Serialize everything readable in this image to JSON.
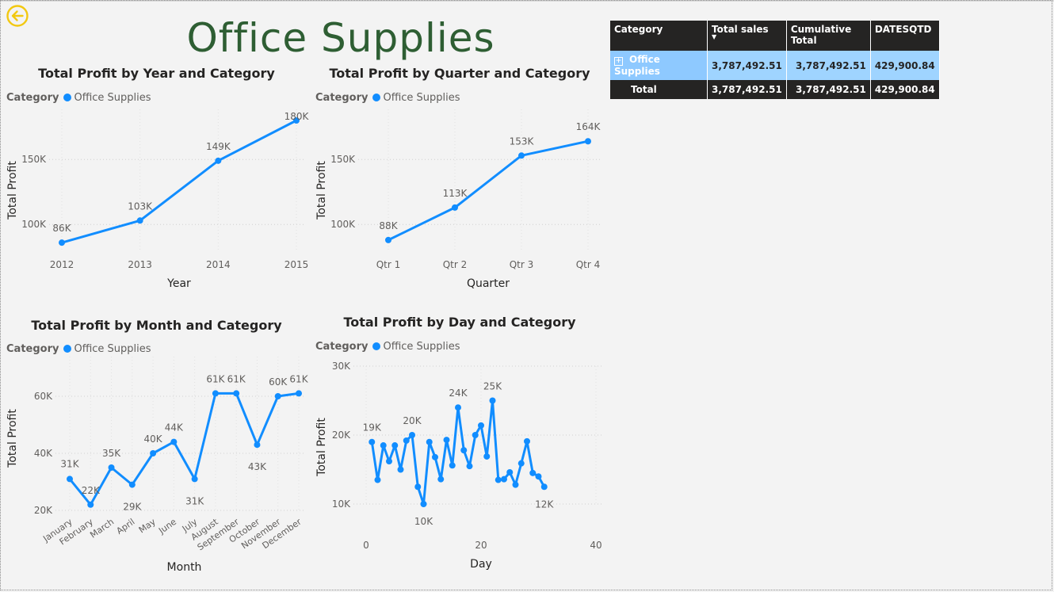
{
  "page": {
    "title": "Office Supplies"
  },
  "nav": {
    "back_icon": "back-arrow-icon",
    "accent": "#f2c811"
  },
  "colors": {
    "series": "#118dff",
    "title": "#2e5e33",
    "table_header": "#252423",
    "table_selected": "#9fd4ff"
  },
  "legend": {
    "label": "Category",
    "item": "Office Supplies"
  },
  "charts": {
    "year": {
      "title": "Total Profit by Year and Category",
      "xlabel": "Year",
      "ylabel": "Total Profit"
    },
    "quarter": {
      "title": "Total Profit by Quarter and Category",
      "xlabel": "Quarter",
      "ylabel": "Total Profit"
    },
    "month": {
      "title": "Total Profit by Month and Category",
      "xlabel": "Month",
      "ylabel": "Total Profit"
    },
    "day": {
      "title": "Total Profit by Day and Category",
      "xlabel": "Day",
      "ylabel": "Total Profit"
    }
  },
  "chart_data": [
    {
      "id": "year",
      "type": "line",
      "title": "Total Profit by Year and Category",
      "xlabel": "Year",
      "ylabel": "Total Profit",
      "categories": [
        "2012",
        "2013",
        "2014",
        "2015"
      ],
      "series": [
        {
          "name": "Office Supplies",
          "values": [
            86000,
            103000,
            149000,
            180000
          ],
          "labels": [
            "86K",
            "103K",
            "149K",
            "180K"
          ]
        }
      ],
      "yticks": [
        100000,
        150000
      ],
      "ytick_labels": [
        "100K",
        "150K"
      ],
      "ylim": [
        80000,
        180000
      ],
      "grid": true,
      "legend": "top-left"
    },
    {
      "id": "quarter",
      "type": "line",
      "title": "Total Profit by Quarter and Category",
      "xlabel": "Quarter",
      "ylabel": "Total Profit",
      "categories": [
        "Qtr 1",
        "Qtr 2",
        "Qtr 3",
        "Qtr 4"
      ],
      "series": [
        {
          "name": "Office Supplies",
          "values": [
            88000,
            113000,
            153000,
            164000
          ],
          "labels": [
            "88K",
            "113K",
            "153K",
            "164K"
          ]
        }
      ],
      "yticks": [
        100000,
        150000
      ],
      "ytick_labels": [
        "100K",
        "150K"
      ],
      "ylim": [
        80000,
        180000
      ],
      "grid": true,
      "legend": "top-left"
    },
    {
      "id": "month",
      "type": "line",
      "title": "Total Profit by Month and Category",
      "xlabel": "Month",
      "ylabel": "Total Profit",
      "categories": [
        "January",
        "February",
        "March",
        "April",
        "May",
        "June",
        "July",
        "August",
        "September",
        "October",
        "November",
        "December"
      ],
      "series": [
        {
          "name": "Office Supplies",
          "values": [
            31000,
            22000,
            35000,
            29000,
            40000,
            44000,
            31000,
            61000,
            61000,
            43000,
            60000,
            61000
          ],
          "labels": [
            "31K",
            "22K",
            "35K",
            "29K",
            "40K",
            "44K",
            "31K",
            "61K",
            "61K",
            "43K",
            "60K",
            "61K"
          ]
        }
      ],
      "yticks": [
        20000,
        40000,
        60000
      ],
      "ytick_labels": [
        "20K",
        "40K",
        "60K"
      ],
      "ylim": [
        20000,
        70000
      ],
      "grid": true,
      "legend": "top-left"
    },
    {
      "id": "day",
      "type": "line",
      "title": "Total Profit by Day and Category",
      "xlabel": "Day",
      "ylabel": "Total Profit",
      "x": [
        1,
        2,
        3,
        4,
        5,
        6,
        7,
        8,
        9,
        10,
        11,
        12,
        13,
        14,
        15,
        16,
        17,
        18,
        19,
        20,
        21,
        22,
        23,
        24,
        25,
        26,
        27,
        28,
        29,
        30,
        31
      ],
      "series": [
        {
          "name": "Office Supplies",
          "values": [
            19000,
            13500,
            18500,
            16200,
            18500,
            15000,
            19200,
            20000,
            12500,
            10000,
            19000,
            16800,
            13600,
            19300,
            15600,
            24000,
            17800,
            15500,
            20000,
            21400,
            16900,
            25000,
            13500,
            13600,
            14600,
            12800,
            15900,
            19100,
            14500,
            14000,
            12500
          ],
          "labels": {
            "1": "19K",
            "8": "20K",
            "10": "10K",
            "16": "24K",
            "22": "25K",
            "31": "12K"
          }
        }
      ],
      "xticks": [
        0,
        20,
        40
      ],
      "yticks": [
        10000,
        20000,
        30000
      ],
      "ytick_labels": [
        "10K",
        "20K",
        "30K"
      ],
      "xlim": [
        0,
        40
      ],
      "ylim": [
        10000,
        30000
      ],
      "grid": true,
      "legend": "top-left"
    }
  ],
  "table": {
    "headers": [
      "Category",
      "Total sales",
      "Cumulative Total",
      "DATESQTD"
    ],
    "rows": [
      {
        "category": "Office Supplies",
        "total_sales": "3,787,492.51",
        "cumulative_total": "3,787,492.51",
        "datesqtd": "429,900.84"
      }
    ],
    "total": {
      "label": "Total",
      "total_sales": "3,787,492.51",
      "cumulative_total": "3,787,492.51",
      "datesqtd": "429,900.84"
    }
  }
}
